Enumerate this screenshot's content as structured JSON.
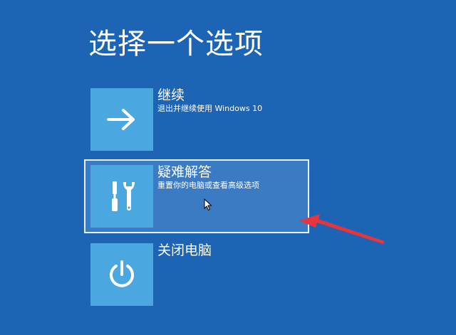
{
  "title": "选择一个选项",
  "options": [
    {
      "label": "继续",
      "description": "退出并继续使用 Windows 10",
      "icon": "arrow-right-icon"
    },
    {
      "label": "疑难解答",
      "description": "重置你的电脑或查看高级选项",
      "icon": "tools-icon"
    },
    {
      "label": "关闭电脑",
      "description": "",
      "icon": "power-icon"
    }
  ],
  "colors": {
    "background": "#1e64b4",
    "tile": "#4ba7e0",
    "selected_background": "#3b7bc3",
    "annotation": "#e8343b"
  }
}
